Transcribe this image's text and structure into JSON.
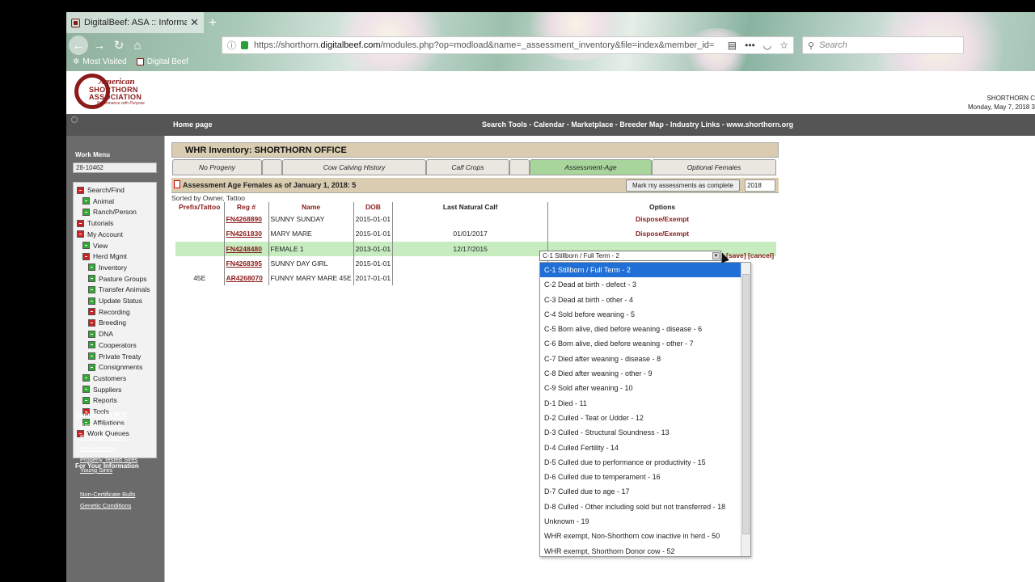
{
  "browser": {
    "tab_title": "DigitalBeef: ASA :: Information",
    "url_prefix": "https://shorthorn.",
    "url_domain": "digitalbeef.com",
    "url_rest": "/modules.php?op=modload&name=_assessment_inventory&file=index&member_id=",
    "search_placeholder": "Search",
    "bookmarks": [
      "Most Visited",
      "Digital Beef"
    ]
  },
  "header": {
    "logo_line1": "American",
    "logo_line2": "SHORTHORN ASSOCIATION",
    "logo_line3": "Performance with Purpose",
    "right_line1": "SHORTHORN C",
    "right_line2": "Monday, May 7, 2018 3"
  },
  "nav": {
    "home": "Home page",
    "links": "Search Tools - Calendar - Marketplace - Breeder Map - Industry Links - www.shorthorn.org"
  },
  "sidebar": {
    "work_menu": "Work Menu",
    "account": "28-10462",
    "items": [
      {
        "label": "Search/Find",
        "color": "r",
        "indent": 0
      },
      {
        "label": "Animal",
        "color": "g",
        "indent": 1
      },
      {
        "label": "Ranch/Person",
        "color": "g",
        "indent": 1
      },
      {
        "label": "Tutorials",
        "color": "r",
        "indent": 0
      },
      {
        "label": "My Account",
        "color": "r",
        "indent": 0
      },
      {
        "label": "View",
        "color": "g",
        "indent": 1
      },
      {
        "label": "Herd Mgmt",
        "color": "r",
        "indent": 1
      },
      {
        "label": "Inventory",
        "color": "g",
        "indent": 2
      },
      {
        "label": "Pasture Groups",
        "color": "g",
        "indent": 2
      },
      {
        "label": "Transfer Animals",
        "color": "g",
        "indent": 2
      },
      {
        "label": "Update Status",
        "color": "g",
        "indent": 2
      },
      {
        "label": "Recording",
        "color": "r",
        "indent": 2
      },
      {
        "label": "Breeding",
        "color": "r",
        "indent": 2
      },
      {
        "label": "DNA",
        "color": "g",
        "indent": 2
      },
      {
        "label": "Cooperators",
        "color": "g",
        "indent": 2
      },
      {
        "label": "Private Treaty",
        "color": "g",
        "indent": 2
      },
      {
        "label": "Consignments",
        "color": "g",
        "indent": 2
      },
      {
        "label": "Customers",
        "color": "g",
        "indent": 1
      },
      {
        "label": "Suppliers",
        "color": "g",
        "indent": 1
      },
      {
        "label": "Reports",
        "color": "g",
        "indent": 1
      },
      {
        "label": "Tools",
        "color": "r",
        "indent": 1
      },
      {
        "label": "Affiliations",
        "color": "g",
        "indent": 1
      },
      {
        "label": "Work Queues",
        "color": "r",
        "indent": 0
      }
    ],
    "fyi": "For Your Information",
    "fyi_links": [
      "Spring 2018 NCE",
      "Genetics Trends",
      "Percentile Ranks",
      "Trait Leaders",
      "Progeny Tested Sires",
      "Young Sires",
      "Non-Certificate Bulls",
      "Genetic Conditions"
    ]
  },
  "main": {
    "title": "WHR Inventory: SHORTHORN OFFICE",
    "tabs": [
      "No Progeny",
      "",
      "Cow Calving History",
      "Calf Crops",
      "",
      "Assessment-Age",
      "Optional Females"
    ],
    "section_title": "Assessment Age Females as of January 1, 2018: 5",
    "mark_button": "Mark my assessments as complete",
    "year": "2018",
    "sorted": "Sorted by Owner, Tattoo",
    "columns": {
      "prefix": "Prefix/Tattoo",
      "reg": "Reg #",
      "name": "Name",
      "dob": "DOB",
      "calf": "Last Natural Calf",
      "options": "Options"
    },
    "rows": [
      {
        "prefix": "",
        "reg": "FN4268890",
        "name": "SUNNY SUNDAY",
        "dob": "2015-01-01",
        "calf": "",
        "option": "Dispose/Exempt"
      },
      {
        "prefix": "",
        "reg": "FN4261830",
        "name": "MARY MARE",
        "dob": "2015-01-01",
        "calf": "01/01/2017",
        "option": "Dispose/Exempt"
      },
      {
        "prefix": "",
        "reg": "FN4248480",
        "name": "FEMALE 1",
        "dob": "2013-01-01",
        "calf": "12/17/2015",
        "option": ""
      },
      {
        "prefix": "",
        "reg": "FN4268395",
        "name": "SUNNY DAY GIRL",
        "dob": "2015-01-01",
        "calf": "",
        "option": ""
      },
      {
        "prefix": "45E",
        "reg": "AR4268070",
        "name": "FUNNY MARY MARE 45E",
        "dob": "2017-01-01",
        "calf": "",
        "option": ""
      }
    ],
    "select_value": "C-1 Stillborn / Full Term - 2",
    "save": "[save]",
    "cancel": "[cancel]",
    "options": [
      "C-1 Stillborn / Full Term - 2",
      "C-2 Dead at birth - defect - 3",
      "C-3 Dead at birth - other - 4",
      "C-4 Sold before weaning - 5",
      "C-5 Born alive, died before weaning - disease - 6",
      "C-6 Born alive, died before weaning - other - 7",
      "C-7 Died after weaning - disease - 8",
      "C-8 Died after weaning - other - 9",
      "C-9 Sold after weaning - 10",
      "D-1 Died - 11",
      "D-2 Culled - Teat or Udder - 12",
      "D-3 Culled - Structural Soundness - 13",
      "D-4 Culled Fertility - 14",
      "D-5 Culled due to performance or productivity - 15",
      "D-6 Culled due to temperament - 16",
      "D-7 Culled due to age - 17",
      "D-8 Culled - Other including sold but not transferred - 18",
      "Unknown - 19",
      "WHR exempt, Non-Shorthorn cow inactive in herd - 50",
      "WHR exempt, Shorthorn Donor cow - 52"
    ]
  }
}
